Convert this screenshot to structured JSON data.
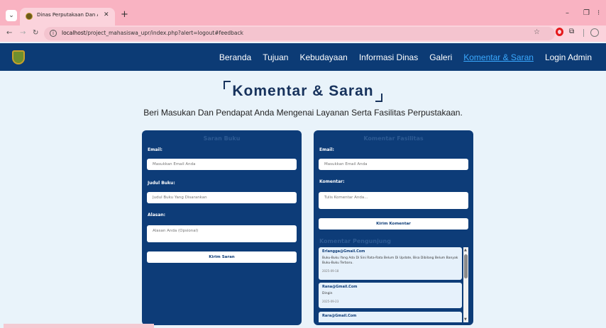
{
  "browser": {
    "tab_title": "Dinas Perputakaan Dan Arsip K",
    "tab_close": "✕",
    "new_tab": "+",
    "url_host": "localhost",
    "url_path": "/project_mahasiswa_upr/index.php?alert=logout#feedback",
    "win_min": "–",
    "win_max": "❐",
    "win_close": "⁝"
  },
  "nav": {
    "links": [
      "Beranda",
      "Tujuan",
      "Kebudayaan",
      "Informasi Dinas",
      "Galeri",
      "Komentar & Saran",
      "Login Admin"
    ],
    "active_index": 5
  },
  "page": {
    "title": "Komentar & Saran",
    "subtitle": "Beri Masukan Dan Pendapat Anda Mengenai Layanan Serta Fasilitas Perpustakaan."
  },
  "book_form": {
    "title": "Saran Buku",
    "email_label": "Email:",
    "email_placeholder": "Masukkan Email Anda",
    "book_label": "Judul Buku:",
    "book_placeholder": "Judul Buku Yang Disarankan",
    "reason_label": "Alasan:",
    "reason_placeholder": "Alasan Anda (Opsional)",
    "submit": "Kirim Saran"
  },
  "comment_form": {
    "title": "Komentar Fasilitas",
    "email_label": "Email:",
    "email_placeholder": "Masukkan Email Anda",
    "comment_label": "Komentar:",
    "comment_placeholder": "Tulis Komentar Anda...",
    "submit": "Kirim Komentar"
  },
  "visitor_comments": {
    "title": "Komentar Pengunjung",
    "items": [
      {
        "email": "Erlangga@Gmail.Com",
        "text": "Buku-Buku Yang Ada Di Sini Rata-Rata Belum Di Update, Bisa Dibilang Belum Banyak Buku-Buku Terbaru.",
        "date": "2025-09-18"
      },
      {
        "email": "Rana@Gmail.Com",
        "text": "Dingin",
        "date": "2025-09-23"
      },
      {
        "email": "Rara@Gmail.Com",
        "text": "",
        "date": ""
      }
    ]
  },
  "colors": {
    "nav_bg": "#0c3b75",
    "active_link": "#3aa9ff",
    "card_bg": "#0d3c78",
    "page_bg": "#e9f3fa",
    "browser_chrome": "#f9b3c2"
  }
}
